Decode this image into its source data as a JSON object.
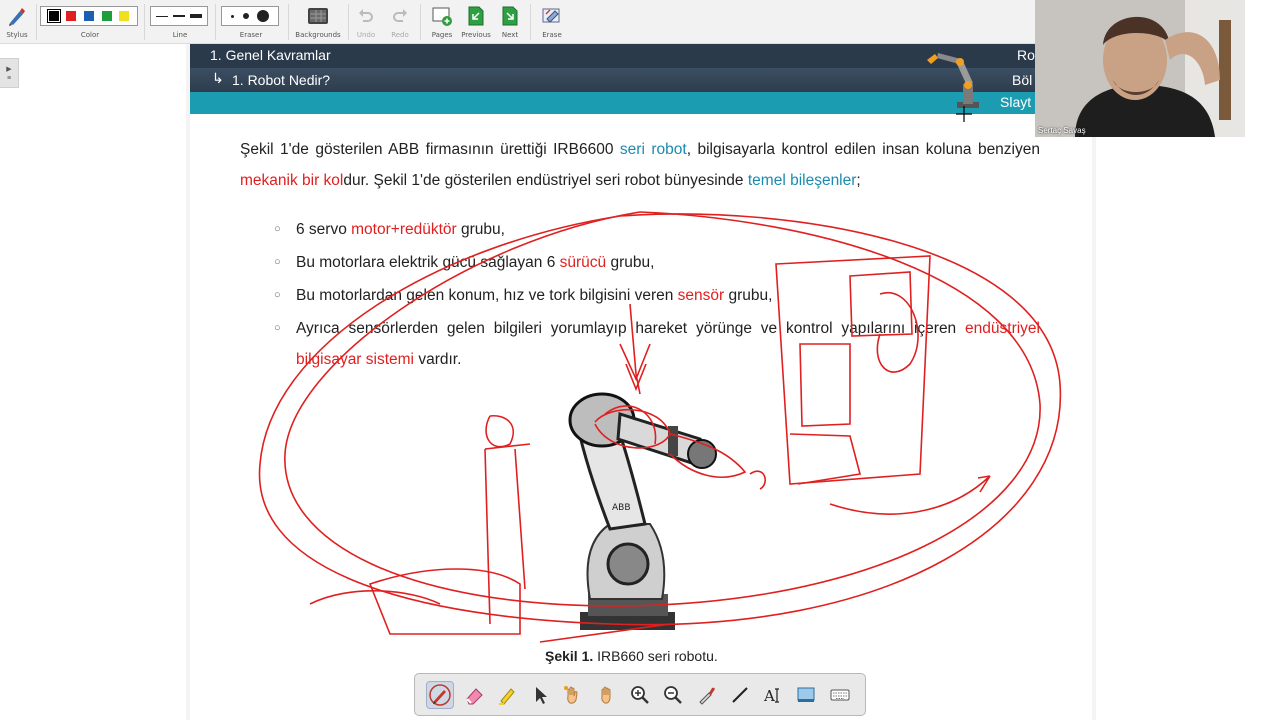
{
  "toolbar": {
    "stylus_label": "Stylus",
    "color_label": "Color",
    "line_label": "Line",
    "eraser_label": "Eraser",
    "backgrounds_label": "Backgrounds",
    "undo_label": "Undo",
    "redo_label": "Redo",
    "pages_label": "Pages",
    "previous_label": "Previous",
    "next_label": "Next",
    "erase_label": "Erase",
    "colors": [
      "#000000",
      "#e02020",
      "#1a5fb4",
      "#1e9e3a",
      "#f0e020"
    ],
    "selected_color": "#000000"
  },
  "slide": {
    "section_title": "1. Genel Kavramlar",
    "subsection_title": "1. Robot Nedir?",
    "right_label_1": "Ro",
    "right_label_2": "Böl",
    "right_label_3": "Slayt",
    "paragraph": {
      "p1": "Şekil 1'de gösterilen ABB firmasının ürettiği IRB6600 ",
      "h1": "seri robot",
      "p2": ", bilgisayarla kontrol edilen insan koluna benziyen ",
      "h2": "mekanik bir kol",
      "p3": "dur. Şekil 1'de gösterilen endüstriyel seri robot bünyesinde ",
      "h3": "temel bileşenler",
      "p4": ";"
    },
    "bullets": [
      {
        "a": "6 servo ",
        "h": "motor+redüktör",
        "b": " grubu,"
      },
      {
        "a": "Bu motorlara elektrik gücü sağlayan 6 ",
        "h": "sürücü",
        "b": " grubu,"
      },
      {
        "a": "Bu motorlardan gelen konum, hız ve tork bilgisini veren ",
        "h": "sensör",
        "b": " grubu,"
      },
      {
        "a": "Ayrıca sensörlerden gelen bilgileri yorumlayıp hareket yörünge ve kontrol yapılarını içeren ",
        "h": "endüstriyel bilgisayar sistemi",
        "b": " vardır."
      }
    ],
    "bullet_symbol": "○",
    "caption_bold": "Şekil 1.",
    "caption_text": " IRB660 seri robotu."
  },
  "webcam": {
    "name": "Sertaç Savaş"
  },
  "palette": {
    "tools": [
      "pen-icon",
      "eraser-icon",
      "highlighter-icon",
      "pointer-icon",
      "laser-hand-icon",
      "pan-hand-icon",
      "zoom-in-icon",
      "zoom-out-icon",
      "eyedropper-icon",
      "line-icon",
      "text-icon",
      "screen-capture-icon",
      "keyboard-icon"
    ],
    "selected": "pen-icon"
  },
  "side_tab": {
    "arrow": "▶"
  }
}
